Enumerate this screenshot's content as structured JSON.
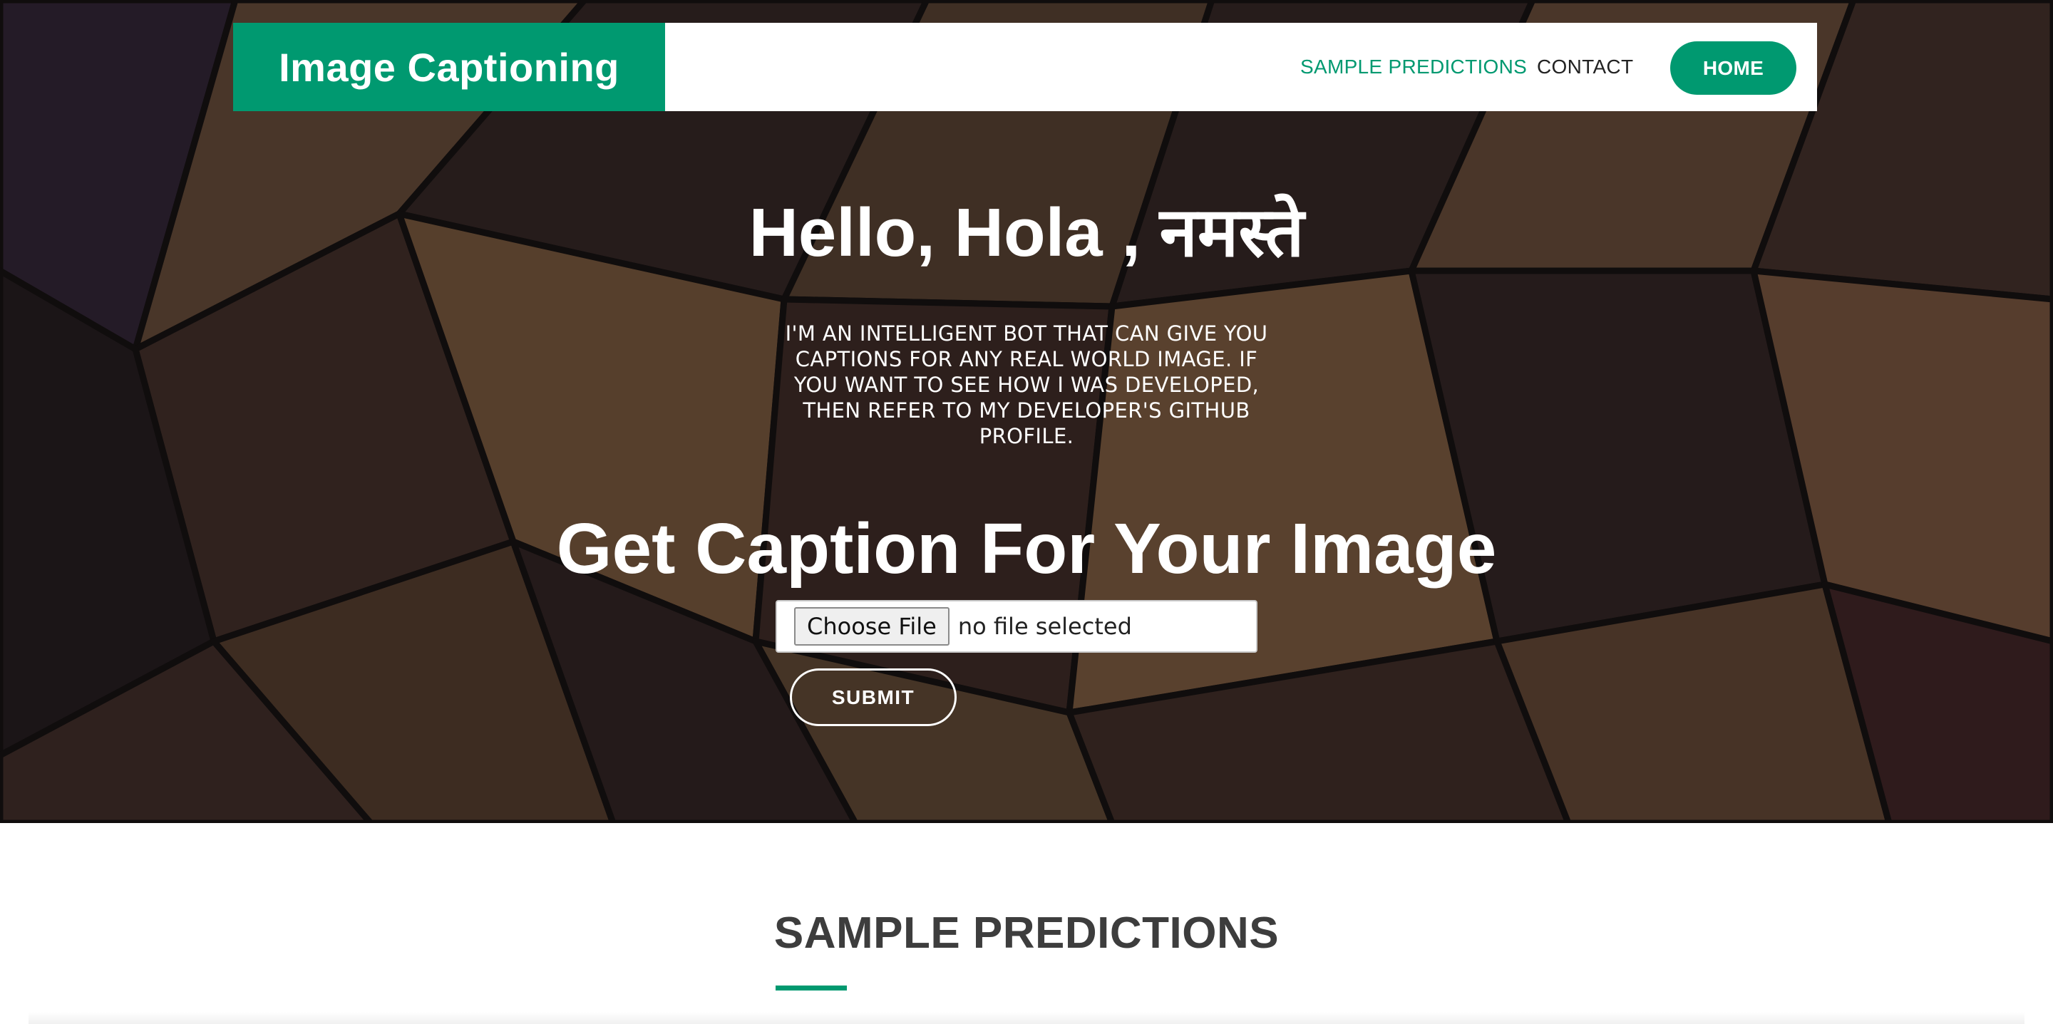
{
  "navbar": {
    "brand": "Image Captioning",
    "links": {
      "sample_predictions": "SAMPLE PREDICTIONS",
      "contact": "CONTACT",
      "home": "HOME"
    }
  },
  "hero": {
    "greeting": "Hello, Hola , नमस्ते",
    "intro": "I'M AN INTELLIGENT BOT THAT CAN GIVE YOU CAPTIONS FOR ANY REAL WORLD IMAGE. IF YOU WANT TO SEE HOW I WAS DEVELOPED, THEN REFER TO MY DEVELOPER'S GITHUB PROFILE.",
    "caption_heading": "Get Caption For Your Image",
    "file_input": {
      "button_label": "Choose File",
      "status": "no file selected"
    },
    "submit_label": "SUBMIT"
  },
  "section": {
    "title": "SAMPLE PREDICTIONS"
  },
  "colors": {
    "accent": "#009970",
    "heading_dark": "#3d3d3d"
  }
}
